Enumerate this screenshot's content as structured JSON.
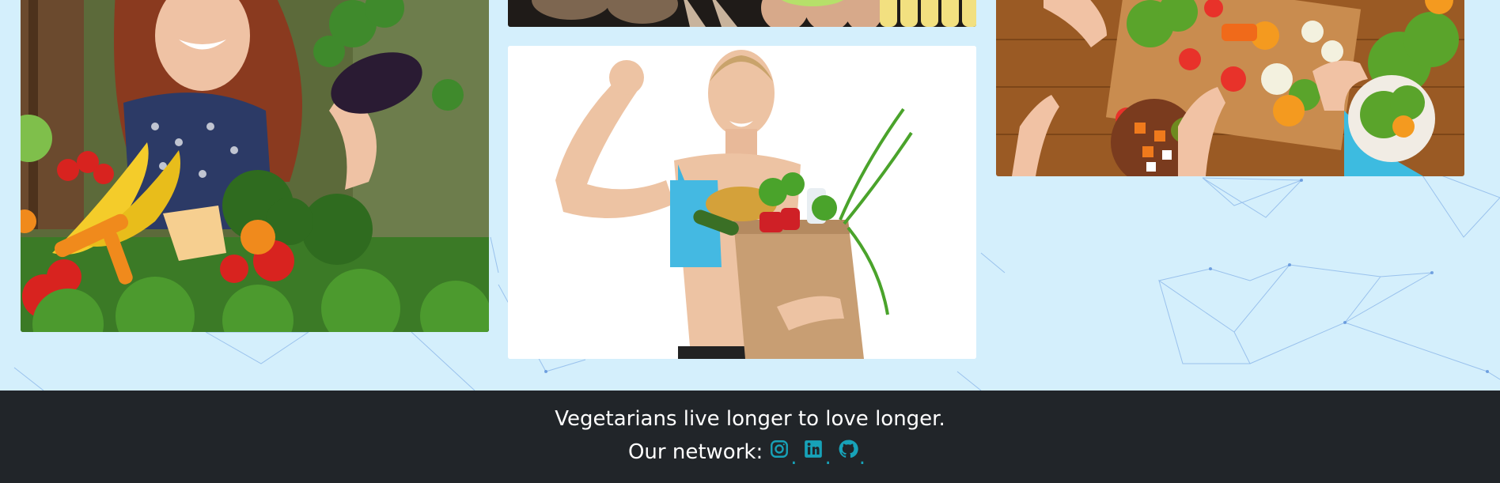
{
  "footer": {
    "tagline": "Vegetarians live longer to love longer.",
    "network_label": "Our network:",
    "separator": ".",
    "social": [
      {
        "name": "instagram",
        "icon": "instagram-icon"
      },
      {
        "name": "linkedin",
        "icon": "linkedin-icon"
      },
      {
        "name": "github",
        "icon": "github-icon"
      }
    ]
  },
  "colors": {
    "page_background": "#d4effc",
    "footer_background": "#212529",
    "footer_text": "#ffffff",
    "link_accent": "#17a2b8",
    "network_lines": "#5a8fd8"
  },
  "gallery": {
    "photos": [
      {
        "name": "woman-with-vegetables-photo"
      },
      {
        "name": "vegetable-strip-photo"
      },
      {
        "name": "fitness-woman-grocery-bag-photo"
      },
      {
        "name": "salad-preparation-table-photo"
      }
    ]
  }
}
